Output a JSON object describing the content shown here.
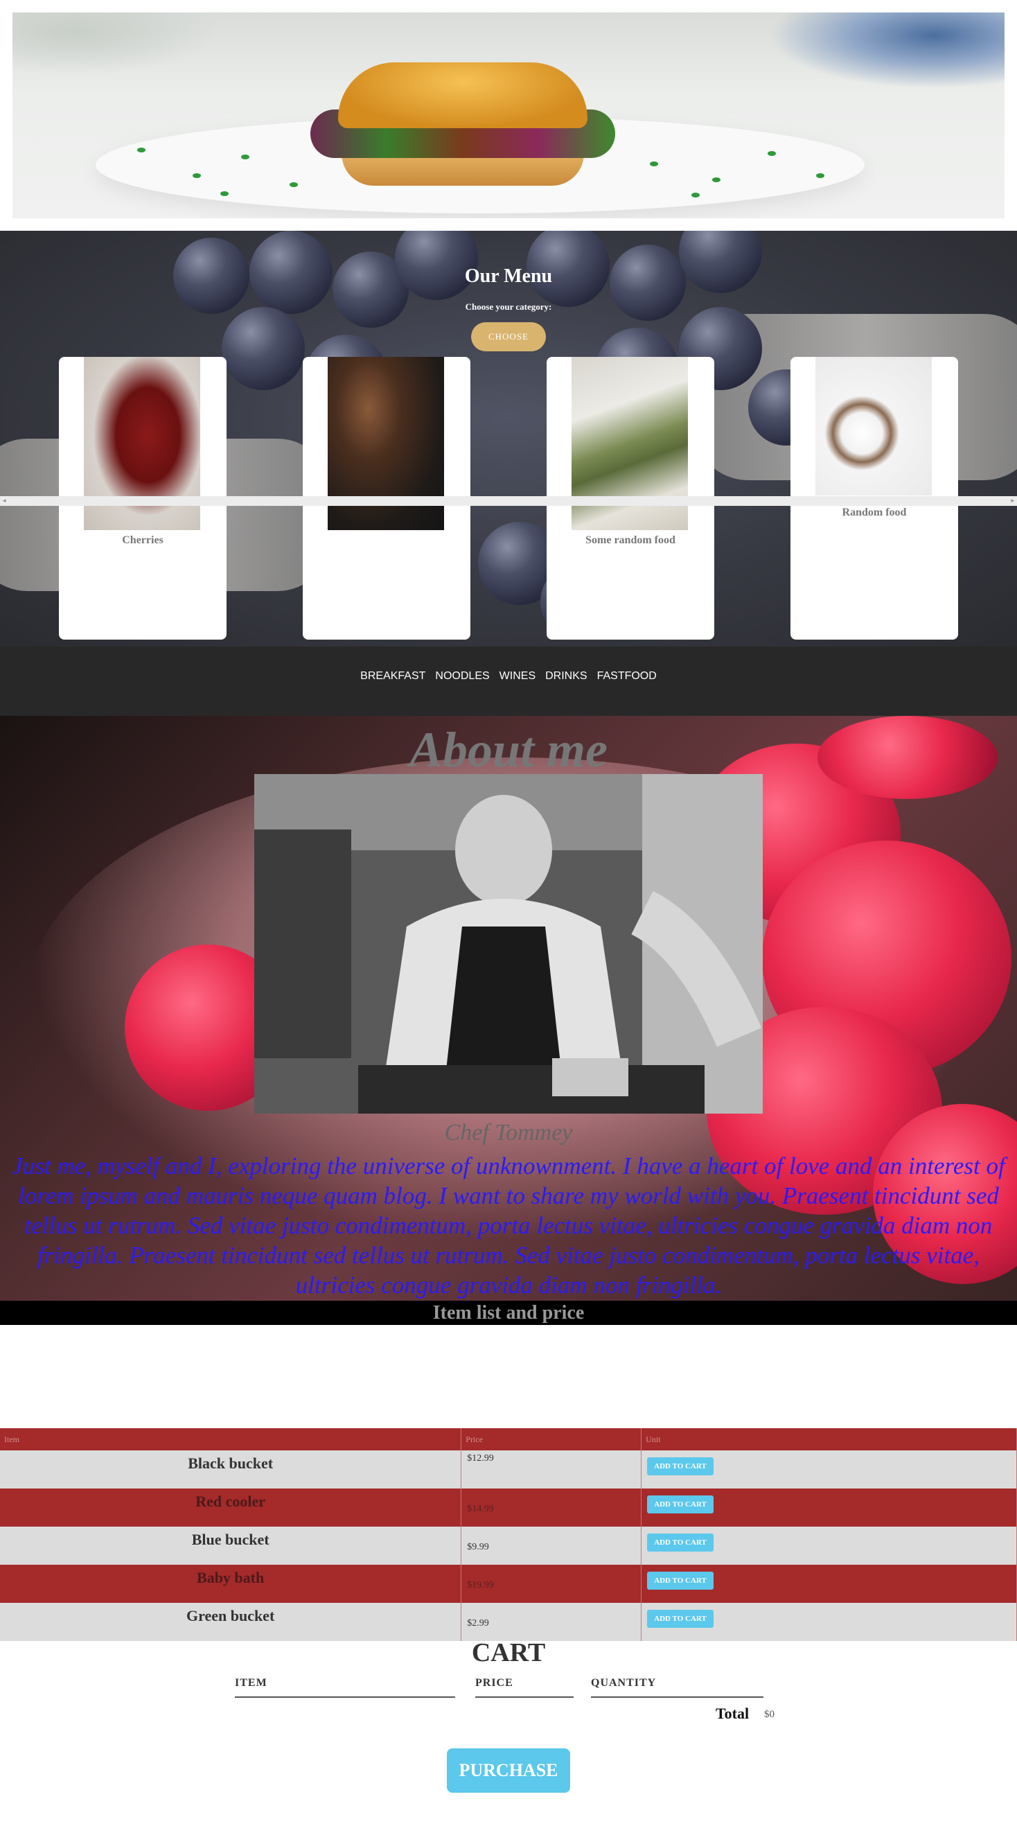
{
  "menu": {
    "title": "Our Menu",
    "subtitle": "Choose your category:",
    "choose_label": "CHOOSE",
    "cards": [
      {
        "name": "Cherries"
      },
      {
        "name": ""
      },
      {
        "name": "Some random food"
      },
      {
        "name": "Random food"
      }
    ]
  },
  "categories": [
    "BREAKFAST",
    "NOODLES",
    "WINES",
    "DRINKS",
    "FASTFOOD"
  ],
  "about": {
    "title": "About me",
    "chef": "Chef Tommey",
    "text": "Just me, myself and I, exploring the universe of unknownment. I have a heart of love and an interest of lorem ipsum and mauris neque quam blog. I want to share my world with you. Praesent tincidunt sed tellus ut rutrum. Sed vitae justo condimentum, porta lectus vitae, ultricies congue gravida diam non fringilla. Praesent tincidunt sed tellus ut rutrum. Sed vitae justo condimentum, porta lectus vitae, ultricies congue gravida diam non fringilla."
  },
  "items": {
    "heading": "Item list and price",
    "columns": [
      "Item",
      "Price",
      "Unit"
    ],
    "rows": [
      {
        "name": "Black bucket",
        "price": "$12.99",
        "action": "ADD TO CART"
      },
      {
        "name": "Red cooler",
        "price": "$14.99",
        "action": "ADD TO CART"
      },
      {
        "name": "Blue bucket",
        "price": "$9.99",
        "action": "ADD TO CART"
      },
      {
        "name": "Baby bath",
        "price": "$19.99",
        "action": "ADD TO CART"
      },
      {
        "name": "Green bucket",
        "price": "$2.99",
        "action": "ADD TO CART"
      }
    ]
  },
  "cart": {
    "title": "CART",
    "columns": [
      "ITEM",
      "PRICE",
      "QUANTITY"
    ],
    "total_label": "Total",
    "total_value": "$0",
    "purchase_label": "PURCHASE"
  },
  "colors": {
    "accent_blue": "#5bc8ec",
    "table_red": "#a52a2a",
    "choose_gold": "#d9b46f",
    "about_text": "#2a1aff"
  }
}
